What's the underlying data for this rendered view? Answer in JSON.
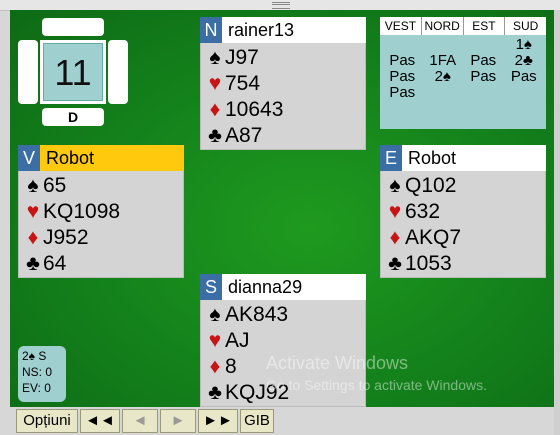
{
  "board": {
    "number": "11",
    "dealer": "D"
  },
  "hands": {
    "north": {
      "seat": "N",
      "player": "rainer13",
      "spades": "J97",
      "hearts": "754",
      "diamonds": "10643",
      "clubs": "A87"
    },
    "west": {
      "seat": "V",
      "player": "Robot",
      "spades": "65",
      "hearts": "KQ1098",
      "diamonds": "J952",
      "clubs": "64"
    },
    "east": {
      "seat": "E",
      "player": "Robot",
      "spades": "Q102",
      "hearts": "632",
      "diamonds": "AKQ7",
      "clubs": "1053"
    },
    "south": {
      "seat": "S",
      "player": "dianna29",
      "spades": "AK843",
      "hearts": "AJ",
      "diamonds": "8",
      "clubs": "KQJ92"
    }
  },
  "suits": {
    "spade": "♠",
    "heart": "♥",
    "diamond": "♦",
    "club": "♣"
  },
  "bidding": {
    "headers": [
      "VEST",
      "NORD",
      "EST",
      "SUD"
    ],
    "rows": [
      [
        "",
        "",
        "",
        "1♠"
      ],
      [
        "Pas",
        "1FA",
        "Pas",
        "2♣"
      ],
      [
        "Pas",
        "2♠",
        "Pas",
        "Pas"
      ],
      [
        "Pas",
        "",
        "",
        ""
      ]
    ]
  },
  "score": {
    "contract": "2♠ S",
    "ns": "NS: 0",
    "ev": "EV: 0"
  },
  "watermark": {
    "line1": "Activate Windows",
    "line2": "Go to Settings to activate Windows."
  },
  "toolbar": {
    "options": "Opțiuni",
    "first": "◄◄",
    "prev": "◄",
    "next": "►",
    "last": "►►",
    "gib": "GIB"
  },
  "colors": {
    "felt": "#13801b",
    "active_player": "#ffc90e",
    "seat_badge": "#3a6ea5",
    "red_suit": "#c81414",
    "panel": "#9fcfcf"
  }
}
